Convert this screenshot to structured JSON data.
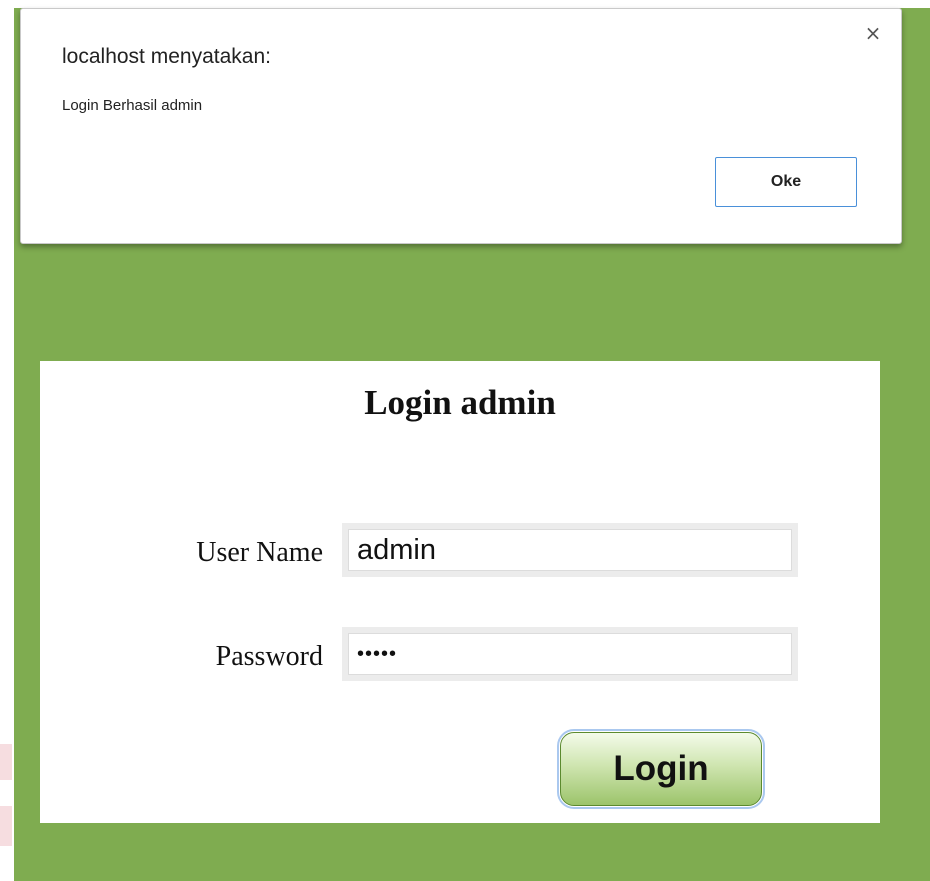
{
  "dialog": {
    "title": "localhost menyatakan:",
    "message": "Login Berhasil admin",
    "close_icon": "×",
    "ok_label": "Oke"
  },
  "login": {
    "title": "Login admin",
    "username_label": "User Name",
    "username_value": "admin",
    "password_label": "Password",
    "password_value": "admin",
    "submit_label": "Login"
  },
  "colors": {
    "page_background": "#7fac50",
    "panel_background": "#ffffff",
    "dialog_button_border": "#4a90d9",
    "login_button_green": "#9cc46b"
  }
}
